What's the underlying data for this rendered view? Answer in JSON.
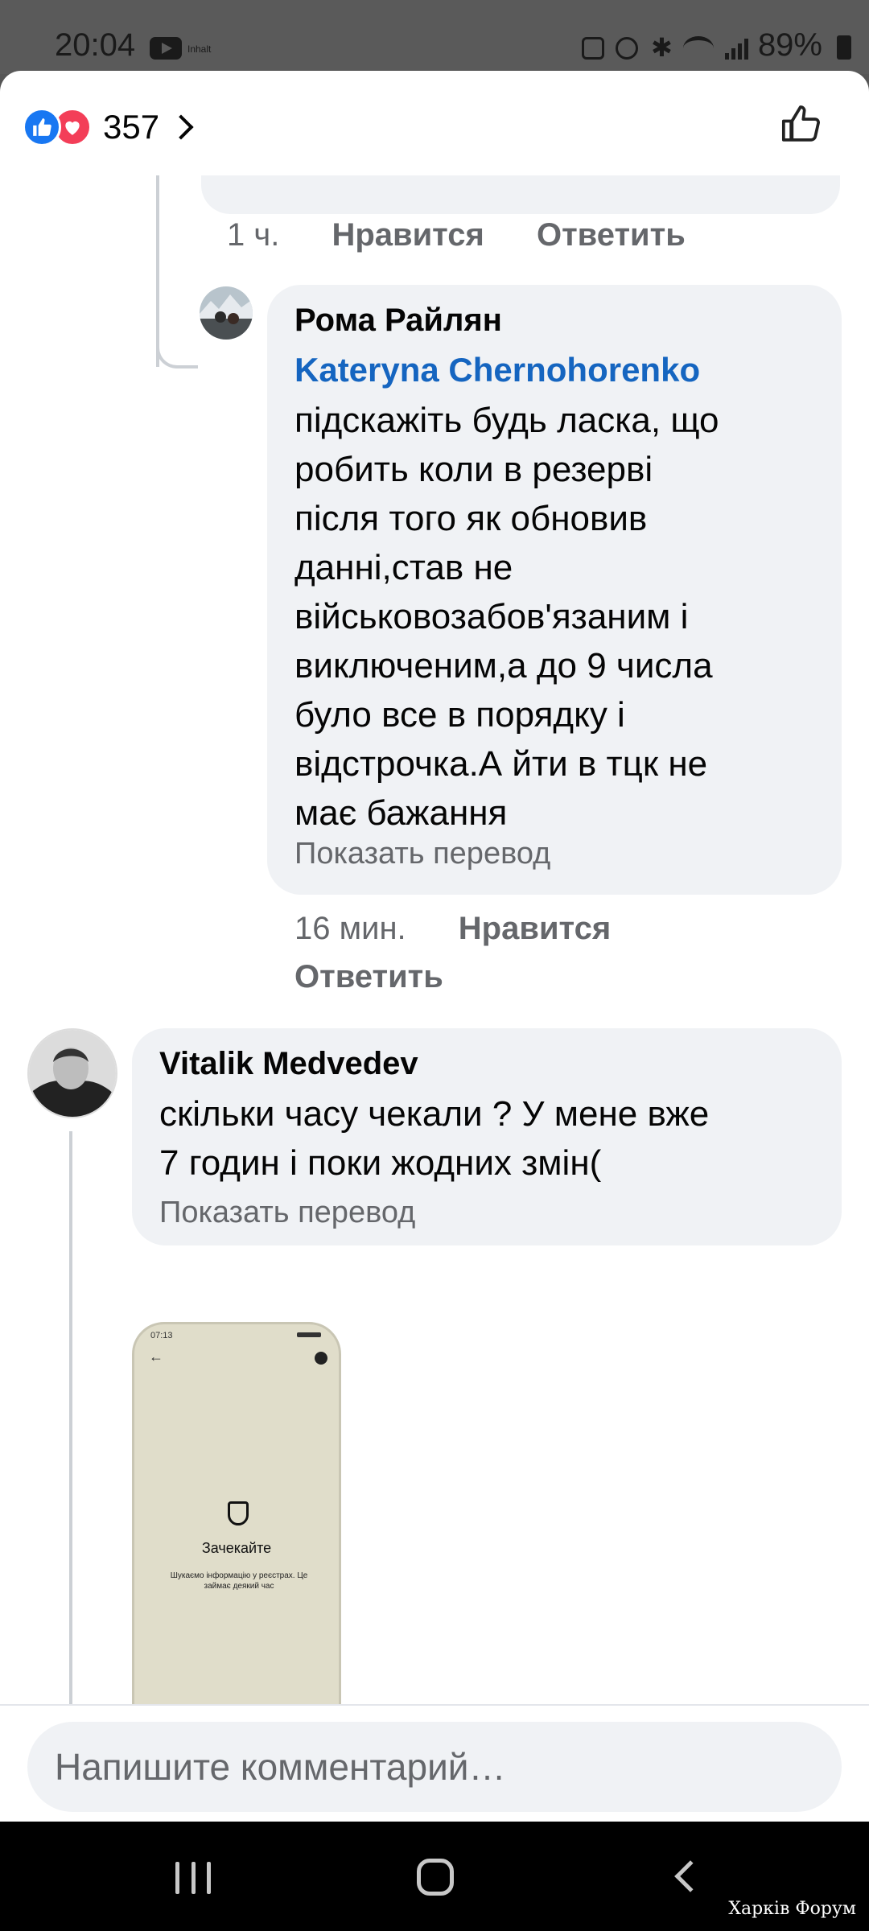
{
  "status_bar": {
    "time": "20:04",
    "battery": "89%",
    "notif_label": "Inhalt"
  },
  "sheet": {
    "reaction_count": "357"
  },
  "previous_actions": {
    "time": "1 ч.",
    "like": "Нравится",
    "reply": "Ответить"
  },
  "comments": [
    {
      "author": "Рома Райлян",
      "mention": "Kateryna Chernohorenko",
      "lines": [
        "підскажіть будь ласка, що",
        "робить коли в резерві",
        "після того як обновив",
        "данні,став не",
        "військовозабов'язаним і",
        "виключеним,а до 9 числа",
        "було все в порядку і",
        "відстрочка.А йти в тцк не",
        "має бажання"
      ],
      "translate": "Показать перевод",
      "time": "16 мин.",
      "like": "Нравится",
      "reply": "Ответить"
    },
    {
      "author": "Vitalik Medvedev",
      "lines": [
        "скільки часу чекали ? У мене вже",
        "7 годин і поки жодних змін("
      ],
      "translate": "Показать перевод"
    }
  ],
  "attachment": {
    "status_time": "07:13",
    "title": "Зачекайте",
    "description": "Шукаємо інформацію у реєстрах. Це займає деякий час"
  },
  "composer": {
    "placeholder": "Напишите комментарий…"
  },
  "watermark": "Харків Форум",
  "colors": {
    "mention": "#1565c0",
    "like_blue": "#1877f2",
    "love_red": "#f33e58",
    "bubble_bg": "#f0f2f5",
    "meta_gray": "#65676b"
  }
}
